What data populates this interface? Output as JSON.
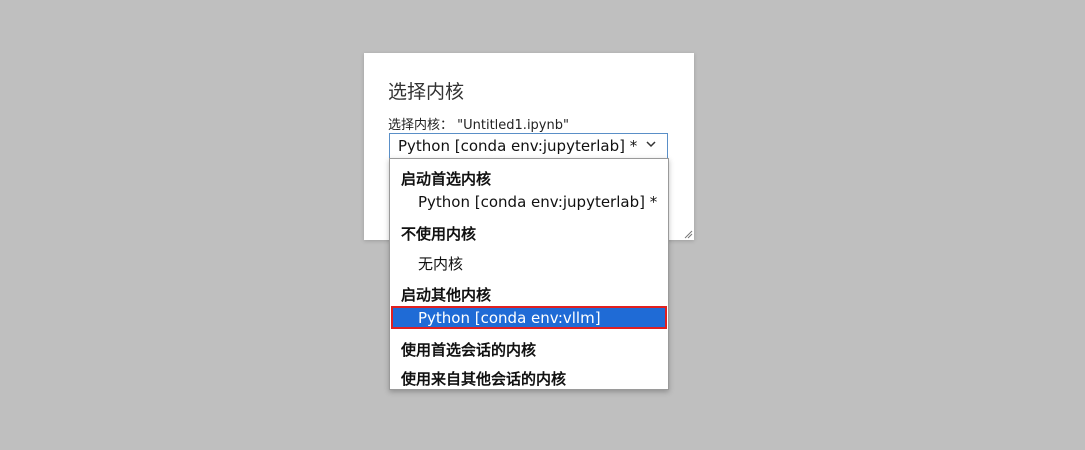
{
  "dialog": {
    "title": "选择内核",
    "label": "选择内核：  \"Untitled1.ipynb\"",
    "selected_value": "Python [conda env:jupyterlab] *"
  },
  "dropdown": {
    "groups": [
      {
        "label": "启动首选内核",
        "items": [
          "Python [conda env:jupyterlab] *"
        ]
      },
      {
        "label": "不使用内核",
        "items": [
          "无内核"
        ]
      },
      {
        "label": "启动其他内核",
        "items": [
          "Python [conda env:vllm]"
        ]
      },
      {
        "label": "使用首选会话的内核",
        "items": []
      },
      {
        "label": "使用来自其他会话的内核",
        "items": []
      }
    ],
    "highlighted": "Python [conda env:vllm]"
  },
  "colors": {
    "background": "#bfbfbf",
    "highlight": "#1f6bd6",
    "highlight_border": "#e02020",
    "select_border": "#5a8fc7"
  },
  "icons": {
    "select_arrow": "chevron-down-icon",
    "resize": "resize-handle-icon"
  }
}
